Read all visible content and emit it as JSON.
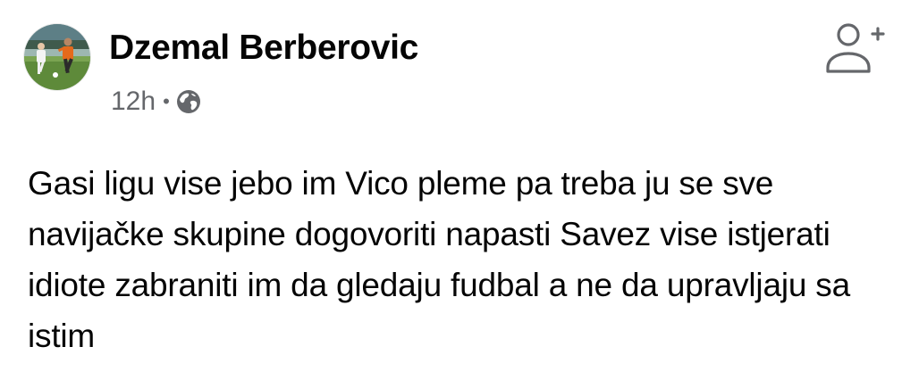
{
  "post": {
    "author": "Dzemal Berberovic",
    "timestamp": "12h",
    "separator": "•",
    "audience_icon": "globe-icon",
    "action_icon": "add-friend-icon",
    "text": "Gasi ligu vise jebo im Vico pleme pa treba ju se sve navijačke skupine dogovoriti napasti Savez vise istjerati idiote zabraniti im da gledaju fudbal a ne da upravljaju sa istim"
  },
  "colors": {
    "text_primary": "#050505",
    "text_secondary": "#65676b",
    "icon_gray": "#65676b",
    "background": "#ffffff"
  }
}
